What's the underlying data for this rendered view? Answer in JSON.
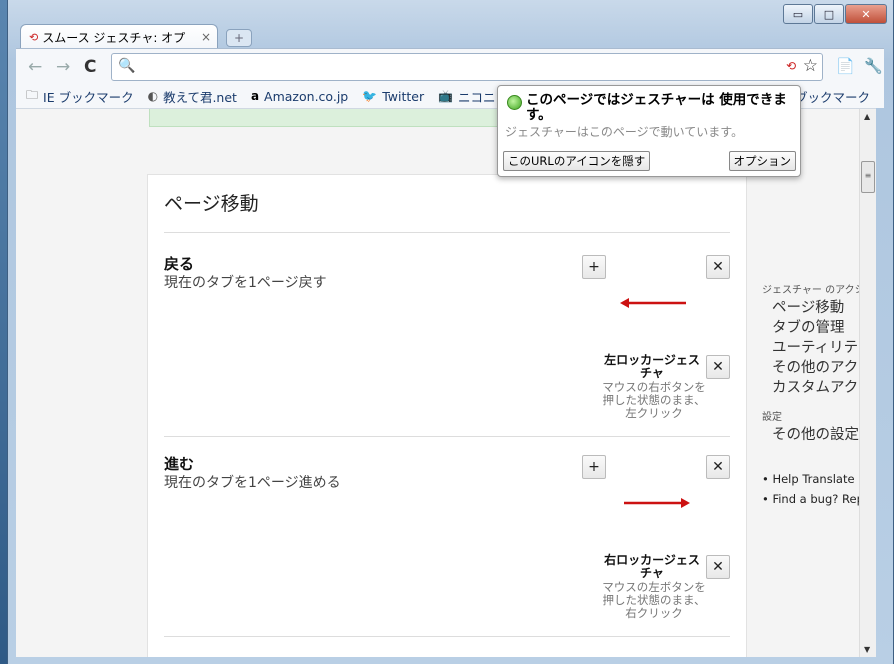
{
  "window": {
    "minimize": "▭",
    "maximize": "□",
    "close": "✕"
  },
  "tab": {
    "title": "スムース ジェスチャ: オプ",
    "close": "×",
    "new_tab": "+"
  },
  "toolbar": {
    "back": "←",
    "forward": "→",
    "reload": "C",
    "gesture_icon": "⟲",
    "star": "☆",
    "page_menu": "📄",
    "wrench": "🔧"
  },
  "omnibox": {
    "value": "",
    "search_glyph": "🔍"
  },
  "bookmarks": [
    {
      "label": "IE ブックマーク",
      "icon": "folder-icon",
      "glyph": "🗀"
    },
    {
      "label": "教えて君.net",
      "icon": "globe-icon",
      "glyph": "◐"
    },
    {
      "label": "Amazon.co.jp",
      "icon": "amazon-icon",
      "glyph": "a"
    },
    {
      "label": "Twitter",
      "icon": "twitter-icon",
      "glyph": "🐦"
    },
    {
      "label": "ニコニコ",
      "icon": "tv-icon",
      "glyph": "📺"
    }
  ],
  "bookmarks_right": "他のブックマーク",
  "popup": {
    "title": "このページではジェスチャーは 使用できます。",
    "subtitle": "ジェスチャーはこのページで動いています。",
    "hide_button": "このURLのアイコンを隠す",
    "options_button": "オプション"
  },
  "page": {
    "section_title": "ページ移動",
    "plus": "+",
    "remove": "✕",
    "actions": [
      {
        "name": "戻る",
        "desc": "現在のタブを1ページ戻す",
        "gesture_title": "左ロッカージェスチャ",
        "gesture_desc": "マウスの右ボタンを押した状態のまま、左クリック",
        "direction": "left"
      },
      {
        "name": "進む",
        "desc": "現在のタブを1ページ進める",
        "gesture_title": "右ロッカージェスチャ",
        "gesture_desc": "マウスの左ボタンを押した状態のまま、右クリック",
        "direction": "right"
      }
    ]
  },
  "sidebar": {
    "actions_heading": "ジェスチャー のアクション",
    "action_links": [
      "ページ移動",
      "タブの管理",
      "ユーティリティー",
      "その他のアクション",
      "カスタムアクション"
    ],
    "settings_heading": "設定",
    "settings_links": [
      "その他の設定"
    ],
    "footer_links": [
      "Help Translate SG",
      "Find a bug? Report"
    ]
  },
  "colors": {
    "arrow": "#cc1111",
    "accent_green": "#3fa520"
  }
}
